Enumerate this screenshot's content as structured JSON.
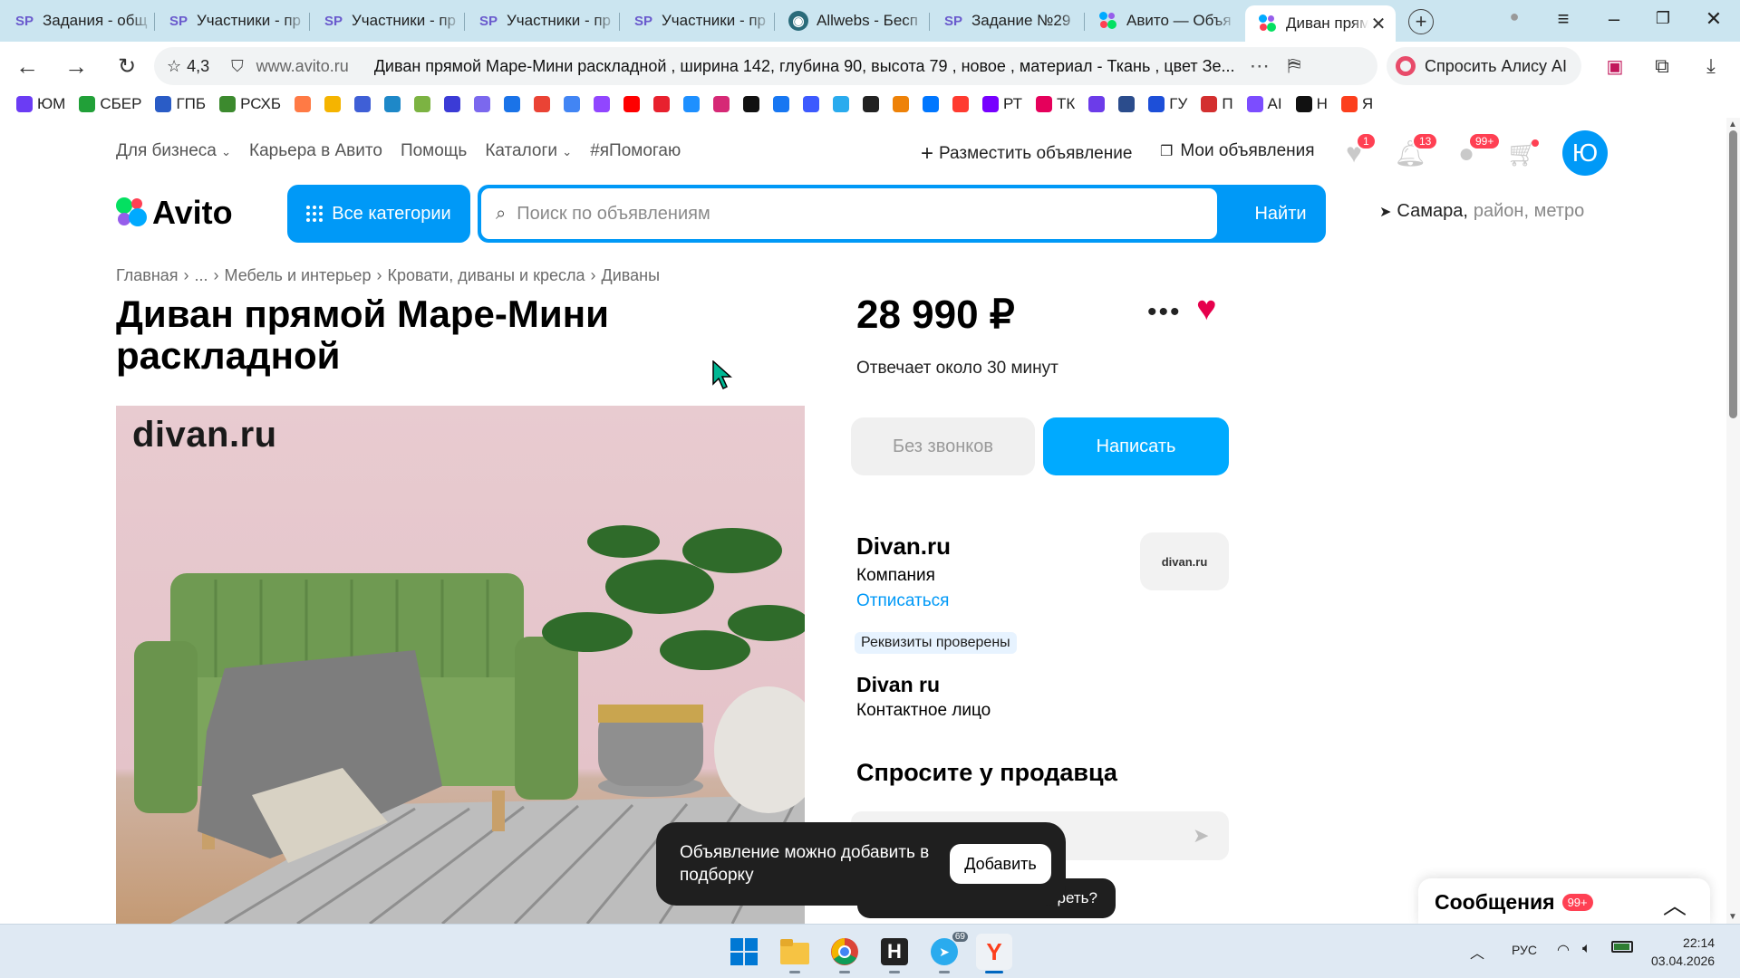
{
  "browser": {
    "tabs": [
      {
        "label": "Задания - общ",
        "icon": "sp-icon"
      },
      {
        "label": "Участники - пр",
        "icon": "sp-icon"
      },
      {
        "label": "Участники - пр",
        "icon": "sp-icon"
      },
      {
        "label": "Участники - пр",
        "icon": "sp-icon"
      },
      {
        "label": "Участники - пр",
        "icon": "sp-icon"
      },
      {
        "label": "Allwebs - Бесп",
        "icon": "allwebs-icon"
      },
      {
        "label": "Задание №29",
        "icon": "sp-icon"
      },
      {
        "label": "Авито — Объя",
        "icon": "avito-icon"
      },
      {
        "label": "Диван прям",
        "icon": "avito-icon",
        "active": true
      }
    ],
    "sp_glyph": "SP",
    "tab_close": "✕",
    "address": {
      "rating": "4,3",
      "domain": "www.avito.ru",
      "page_title": "Диван прямой Маре-Мини раскладной , ширина 142, глубина 90, высота 79 , новое , материал - Ткань , цвет Зе..."
    },
    "alice_label": "Спросить Алису AI",
    "bookmarks": [
      {
        "label": "ЮМ",
        "color": "#6b3cf4"
      },
      {
        "label": "СБЕР",
        "color": "#21a038"
      },
      {
        "label": "ГПБ",
        "color": "#2a5cc6"
      },
      {
        "label": "РСХБ",
        "color": "#3c8a2e"
      },
      {
        "label": "",
        "color": "#ff7a45"
      },
      {
        "label": "",
        "color": "#f5b400"
      },
      {
        "label": "",
        "color": "#3f5fd6"
      },
      {
        "label": "",
        "color": "#1e88c8"
      },
      {
        "label": "",
        "color": "#7cb342"
      },
      {
        "label": "",
        "color": "#3b3bd6"
      },
      {
        "label": "",
        "color": "#7b68ee"
      },
      {
        "label": "",
        "color": "#1a73e8"
      },
      {
        "label": "",
        "color": "#ea4335"
      },
      {
        "label": "",
        "color": "#4285f4"
      },
      {
        "label": "",
        "color": "#9146ff"
      },
      {
        "label": "",
        "color": "#ff0000"
      },
      {
        "label": "",
        "color": "#e8212e"
      },
      {
        "label": "",
        "color": "#1e90ff"
      },
      {
        "label": "",
        "color": "#d62976"
      },
      {
        "label": "",
        "color": "#111111"
      },
      {
        "label": "",
        "color": "#1877f2"
      },
      {
        "label": "",
        "color": "#3d5afe"
      },
      {
        "label": "",
        "color": "#2aabee"
      },
      {
        "label": "",
        "color": "#222222"
      },
      {
        "label": "",
        "color": "#ee8208"
      },
      {
        "label": "",
        "color": "#0077ff"
      },
      {
        "label": "",
        "color": "#ff3b30"
      },
      {
        "label": "РТ",
        "color": "#7700ff"
      },
      {
        "label": "ТК",
        "color": "#e5005b"
      },
      {
        "label": "",
        "color": "#6c3ce9"
      },
      {
        "label": "",
        "color": "#2b4c8c"
      },
      {
        "label": "ГУ",
        "color": "#1d4fd8"
      },
      {
        "label": "П",
        "color": "#d32f2f"
      },
      {
        "label": "AI",
        "color": "#7c4dff"
      },
      {
        "label": "Н",
        "color": "#111111"
      },
      {
        "label": "Я",
        "color": "#fc3f1d"
      }
    ]
  },
  "site": {
    "topnav": [
      "Для бизнеса",
      "Карьера в Авито",
      "Помощь",
      "Каталоги",
      "#яПомогаю"
    ],
    "post_ad": "Разместить объявление",
    "my_ads": "Мои объявления",
    "badges": {
      "favorites": "1",
      "notifications": "13",
      "messages": "99+"
    },
    "avatar_letter": "Ю",
    "logo_text": "Avito",
    "all_categories": "Все категории",
    "search_placeholder": "Поиск по объявлениям",
    "find_button": "Найти",
    "location_city": "Самара,",
    "location_sub": "район, метро"
  },
  "listing": {
    "breadcrumb": [
      "Главная",
      "...",
      "Мебель и интерьер",
      "Кровати, диваны и кресла",
      "Диваны"
    ],
    "breadcrumb_sep": "›",
    "title": "Диван прямой Маре-Мини раскладной",
    "photo_brand": "divan.ru",
    "price": "28 990 ₽",
    "response_time": "Отвечает около 30 минут",
    "btn_no_calls": "Без звонков",
    "btn_write": "Написать",
    "seller": {
      "name": "Divan.ru",
      "type": "Компания",
      "unsubscribe": "Отписаться",
      "logo_text": "divan.ru",
      "verified": "Реквизиты проверены",
      "contact_name": "Divan ru",
      "contact_role": "Контактное лицо"
    },
    "ask_title": "Спросите у продавца",
    "hint_text": "отреть?"
  },
  "toast": {
    "text": "Объявление можно добавить в подборку",
    "button": "Добавить"
  },
  "messages_panel": {
    "title": "Сообщения",
    "badge": "99+"
  },
  "taskbar": {
    "telegram_badge": "69",
    "lang": "РУС",
    "time": "22:14",
    "date": "03.04.2026"
  }
}
